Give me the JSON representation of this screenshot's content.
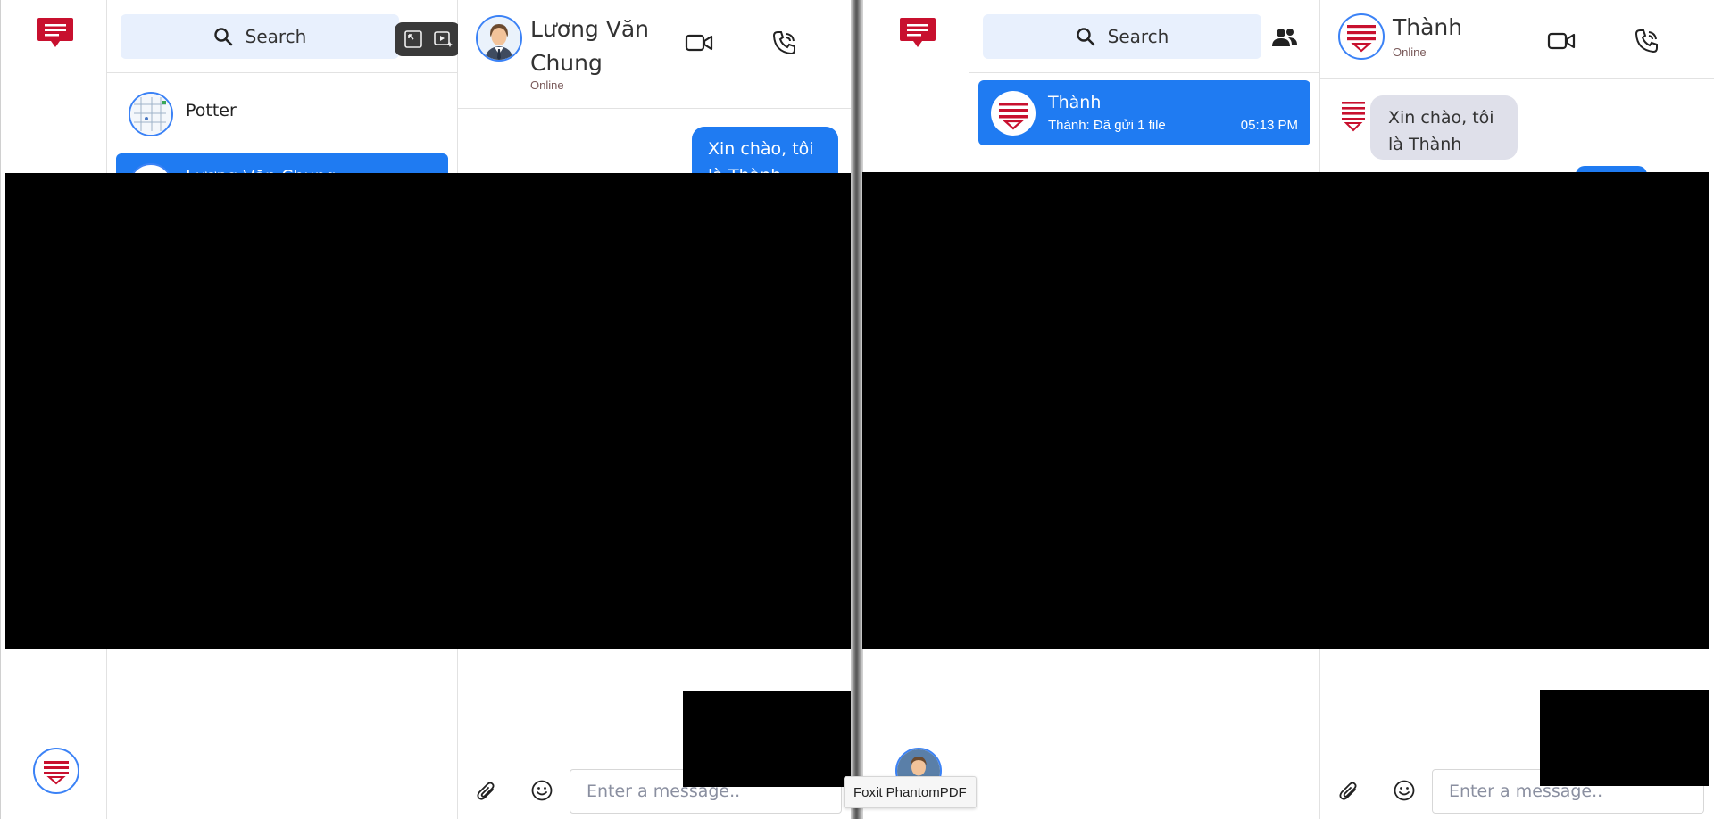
{
  "left_window": {
    "search": {
      "label": "Search"
    },
    "conversations": [
      {
        "name": "Potter"
      },
      {
        "name": "Lương Văn Chung"
      }
    ],
    "chat": {
      "contact_name": "Lương Văn Chung",
      "status": "Online",
      "messages": [
        {
          "direction": "out",
          "text": "Xin chào, tôi là Thành"
        }
      ],
      "composer_placeholder": "Enter a message.."
    }
  },
  "right_window": {
    "search": {
      "label": "Search"
    },
    "conversations": [
      {
        "name": "Thành",
        "preview": "Thành: Đã gửi 1 file",
        "time": "05:13 PM"
      }
    ],
    "chat": {
      "contact_name": "Thành",
      "status": "Online",
      "messages": [
        {
          "direction": "in",
          "text": "Xin chào, tôi là Thành"
        }
      ],
      "composer_placeholder": "Enter a message.."
    }
  },
  "taskbar_tooltip": "Foxit PhantomPDF",
  "colors": {
    "brand_red": "#c8102e",
    "accent_blue": "#1f7bf2",
    "search_bg": "#e8f0fd",
    "incoming_bubble": "#dfe0ea"
  },
  "icons": {
    "nav_logo": "chat-lines-icon",
    "search": "magnifier-icon",
    "video": "video-camera-icon",
    "call": "phone-icon",
    "attach": "paperclip-icon",
    "emoji": "smiley-icon",
    "group": "people-icon"
  }
}
